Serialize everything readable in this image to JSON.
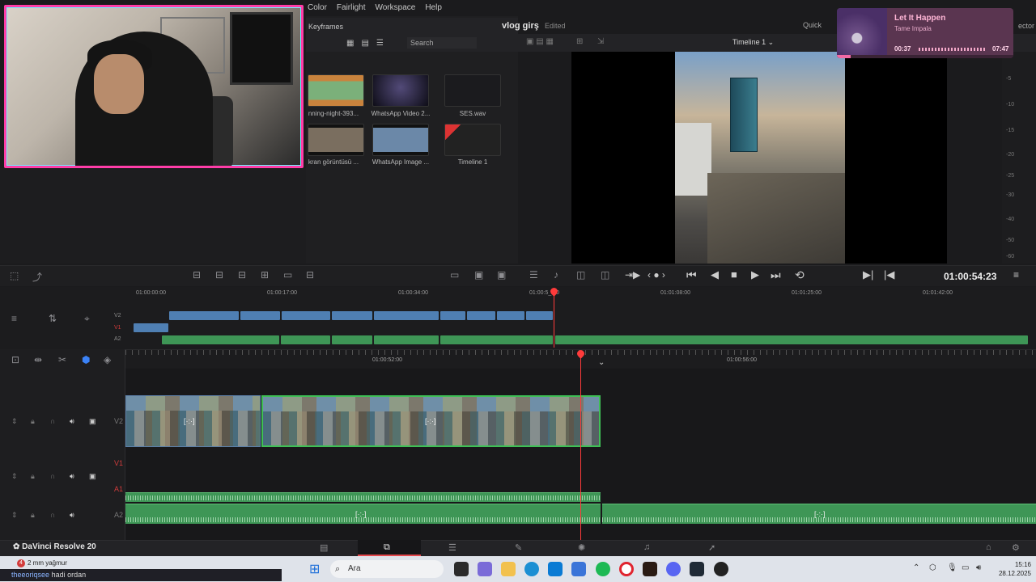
{
  "menu": [
    "Color",
    "Fairlight",
    "Workspace",
    "Help"
  ],
  "media_pool": {
    "tab": "Keyframes",
    "search_placeholder": "Search",
    "clips": [
      {
        "label": "nning-night-393..."
      },
      {
        "label": "WhatsApp Video 2..."
      },
      {
        "label": "SES.wav"
      },
      {
        "label": "kran görüntüsü ..."
      },
      {
        "label": "WhatsApp Image ..."
      },
      {
        "label": "Timeline 1"
      }
    ]
  },
  "project": {
    "title": "vlog girş",
    "status": "Edited",
    "quick": "Quick",
    "inspector_cut": "ector"
  },
  "viewer": {
    "timeline_name": "Timeline 1 ⌄",
    "timecode": "01:00:54:23"
  },
  "meter_ticks": [
    "-5",
    "-10",
    "-15",
    "-20",
    "-25",
    "-30",
    "-40",
    "-50",
    "-60"
  ],
  "music": {
    "title": "Let It Happen",
    "artist": "Tame Impala",
    "elapsed": "00:37",
    "total": "07:47",
    "progress": 0.08
  },
  "mini_ruler": [
    "01:00:00:00",
    "01:00:17:00",
    "01:00:34:00",
    "01:00:5_:00",
    "01:01:08:00",
    "01:01:25:00",
    "01:01:42:00"
  ],
  "mini_tracks": [
    "V2",
    "V1",
    "A2"
  ],
  "timeline_ruler": [
    "01:00:52:00",
    "01:00:56:00"
  ],
  "tracks": [
    {
      "label": "V2",
      "color": "#8a8a8a"
    },
    {
      "label": "V1",
      "color": "#d23b3b"
    },
    {
      "label": "A1",
      "color": "#d23b3b"
    },
    {
      "label": "A2",
      "color": "#8a8a8a"
    }
  ],
  "clip_glyph": "[·:·]",
  "app": {
    "name": "DaVinci Resolve 20"
  },
  "taskbar": {
    "weather": "2 mm yağmur",
    "weather_badge": "4",
    "search": "Ara",
    "time": "15:16",
    "date": "28.12.2025"
  },
  "chat": {
    "user": "theeoriqsee",
    "message": "hadi ordan"
  },
  "colors": {
    "accent": "#e5484d",
    "video_clip": "#4f7fb3",
    "audio_clip": "#3e9656",
    "playhead": "#ff3b3b",
    "webcam_border": "#ff3da8"
  }
}
